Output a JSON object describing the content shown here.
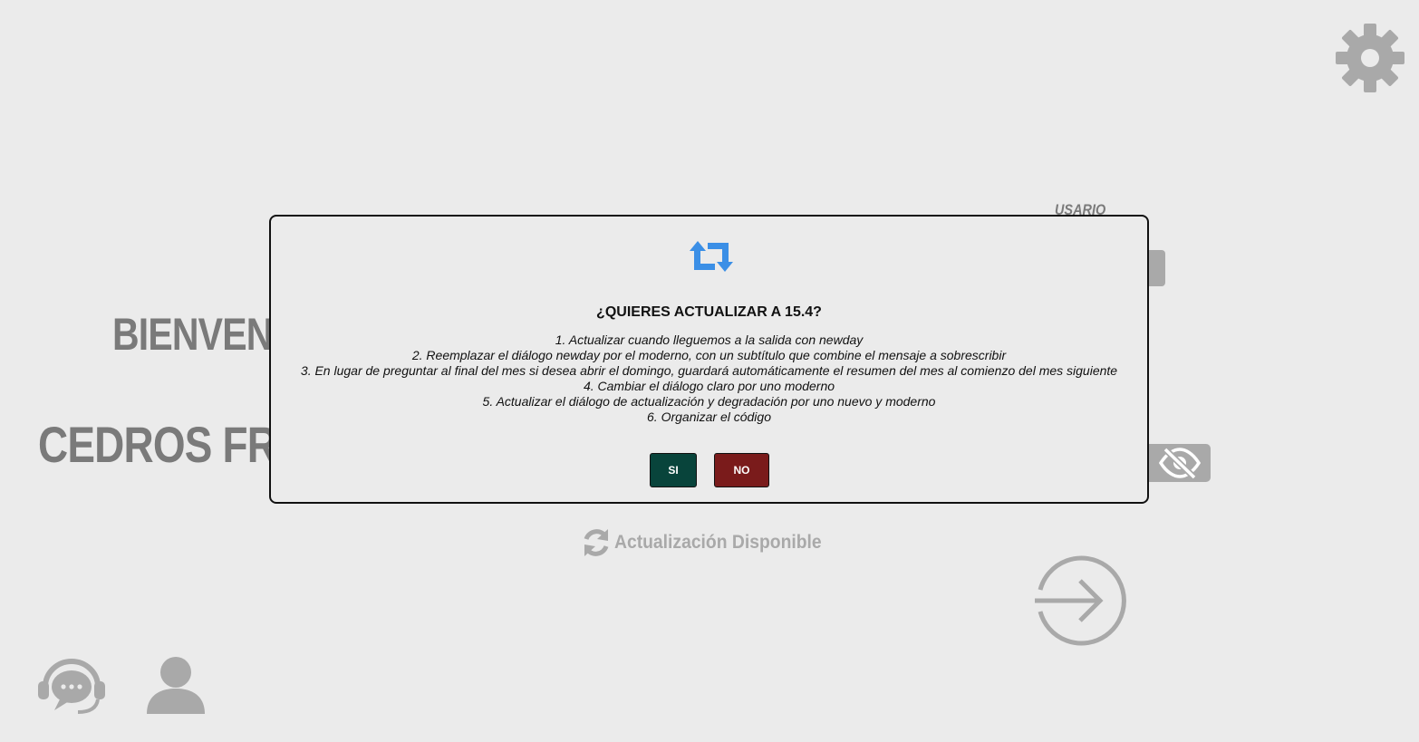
{
  "background": {
    "welcome_text": "BIENVENI",
    "company_text": "CEDROS FREI",
    "user_label": "USARIO",
    "update_available_text": "Actualización Disponible"
  },
  "icons": {
    "settings": "gear-icon",
    "password_toggle": "eye-slash-icon",
    "update": "sync-icon",
    "login": "sign-in-icon",
    "support": "headset-chat-icon",
    "account": "user-icon",
    "dialog": "retweet-icon"
  },
  "dialog": {
    "title": "¿QUIERES ACTUALIZAR A 15.4?",
    "changes": [
      "1. Actualizar cuando lleguemos a la salida con newday",
      "2. Reemplazar el diálogo newday por el moderno, con un subtítulo que combine el mensaje a sobrescribir",
      "3. En lugar de preguntar al final del mes si desea abrir el domingo, guardará automáticamente el resumen del mes al comienzo del mes siguiente",
      "4. Cambiar el diálogo claro por uno moderno",
      "5. Actualizar el diálogo de actualización y degradación por uno nuevo y moderno",
      "6. Organizar el código"
    ],
    "yes_label": "SI",
    "no_label": "NO"
  },
  "colors": {
    "background": "#ebebeb",
    "muted": "#a9a9a9",
    "yes_button": "#08443b",
    "no_button": "#7a1b1b",
    "dialog_icon": "#3b8fe6"
  }
}
